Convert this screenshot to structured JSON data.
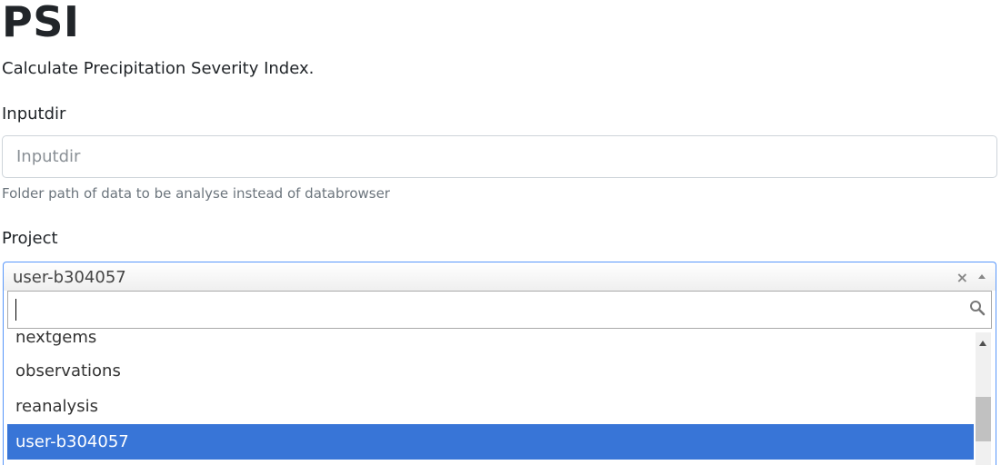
{
  "page": {
    "title": "PSI",
    "description": "Calculate Precipitation Severity Index."
  },
  "fields": {
    "inputdir": {
      "label": "Inputdir",
      "value": "",
      "placeholder": "Inputdir",
      "help": "Folder path of data to be analyse instead of databrowser"
    },
    "project": {
      "label": "Project",
      "selected": "user-b304057",
      "clear_icon": "×",
      "search_value": "",
      "options": [
        "nextgems",
        "observations",
        "reanalysis",
        "user-b304057"
      ],
      "highlighted": "user-b304057"
    }
  },
  "colors": {
    "highlight": "#3875d7",
    "focus_border": "#5897fb",
    "text": "#212529",
    "muted": "#6c757d"
  },
  "icons": {
    "search": "search-icon",
    "clear": "clear-icon",
    "arrow": "chevron-up-icon"
  }
}
